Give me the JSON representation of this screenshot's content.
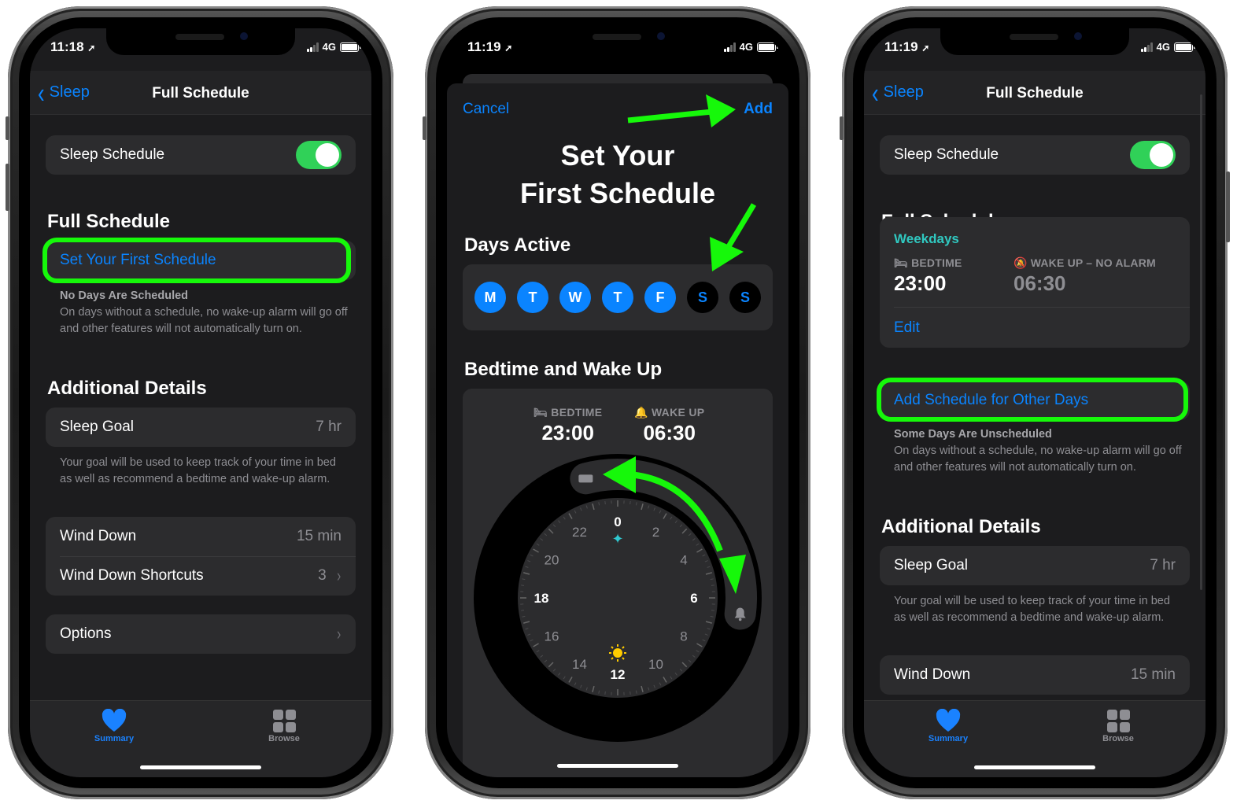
{
  "phones": [
    {
      "status": {
        "time": "11:18",
        "network": "4G"
      },
      "nav": {
        "back_label": "Sleep",
        "title": "Full Schedule"
      },
      "sleep_schedule": {
        "label": "Sleep Schedule",
        "enabled": true
      },
      "full_schedule": {
        "heading": "Full Schedule",
        "action_label": "Set Your First Schedule",
        "footer_title": "No Days Are Scheduled",
        "footer_text": "On days without a schedule, no wake-up alarm will go off and other features will not automatically turn on."
      },
      "additional": {
        "heading": "Additional Details",
        "sleep_goal": {
          "label": "Sleep Goal",
          "value": "7 hr"
        },
        "goal_footer": "Your goal will be used to keep track of your time in bed as well as recommend a bedtime and wake-up alarm.",
        "wind_down": {
          "label": "Wind Down",
          "value": "15 min"
        },
        "wind_down_shortcuts": {
          "label": "Wind Down Shortcuts",
          "value": "3"
        },
        "options": {
          "label": "Options"
        }
      },
      "tabs": [
        {
          "label": "Summary",
          "icon": "heart-icon",
          "active": true
        },
        {
          "label": "Browse",
          "icon": "grid-icon",
          "active": false
        }
      ]
    },
    {
      "status": {
        "time": "11:19",
        "network": "4G"
      },
      "sheet": {
        "cancel_label": "Cancel",
        "add_label": "Add",
        "title_line1": "Set Your",
        "title_line2": "First Schedule",
        "days_heading": "Days Active",
        "days": [
          {
            "letter": "M",
            "active": true
          },
          {
            "letter": "T",
            "active": true
          },
          {
            "letter": "W",
            "active": true
          },
          {
            "letter": "T",
            "active": true
          },
          {
            "letter": "F",
            "active": true
          },
          {
            "letter": "S",
            "active": false
          },
          {
            "letter": "S",
            "active": false
          }
        ],
        "bedtime_heading": "Bedtime and Wake Up",
        "bedtime_label": "BEDTIME",
        "bedtime_value": "23:00",
        "wakeup_label": "WAKE UP",
        "wakeup_value": "06:30",
        "clock_hours": [
          "0",
          "2",
          "4",
          "6",
          "8",
          "10",
          "12",
          "14",
          "16",
          "18",
          "20",
          "22"
        ],
        "bedtime_hour": 23,
        "wakeup_hour": 6.5
      }
    },
    {
      "status": {
        "time": "11:19",
        "network": "4G"
      },
      "nav": {
        "back_label": "Sleep",
        "title": "Full Schedule"
      },
      "sleep_schedule": {
        "label": "Sleep Schedule",
        "enabled": true
      },
      "full_schedule": {
        "heading": "Full Schedule",
        "schedule_name": "Weekdays",
        "bedtime_label": "BEDTIME",
        "bedtime_value": "23:00",
        "wakeup_label": "WAKE UP – NO ALARM",
        "wakeup_value": "06:30",
        "edit_label": "Edit",
        "action_label": "Add Schedule for Other Days",
        "footer_title": "Some Days Are Unscheduled",
        "footer_text": "On days without a schedule, no wake-up alarm will go off and other features will not automatically turn on."
      },
      "additional": {
        "heading": "Additional Details",
        "sleep_goal": {
          "label": "Sleep Goal",
          "value": "7 hr"
        },
        "goal_footer": "Your goal will be used to keep track of your time in bed as well as recommend a bedtime and wake-up alarm.",
        "wind_down": {
          "label": "Wind Down",
          "value": "15 min"
        }
      },
      "tabs": [
        {
          "label": "Summary",
          "icon": "heart-icon",
          "active": true
        },
        {
          "label": "Browse",
          "icon": "grid-icon",
          "active": false
        }
      ]
    }
  ],
  "colors": {
    "accent_blue": "#0a84ff",
    "toggle_green": "#30d158",
    "annotation_green": "#16f80a",
    "weekdays_teal": "#30c8c0"
  }
}
